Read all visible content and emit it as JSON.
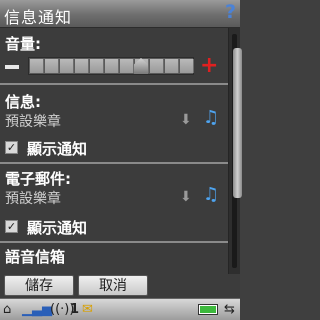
{
  "title": "信息通知",
  "help_glyph": "?",
  "volume": {
    "label": "音量:",
    "minus_glyph": "−",
    "plus_glyph": "+",
    "level": 0.7
  },
  "sections": [
    {
      "label": "信息:",
      "value": "預設樂章",
      "checkbox_label": "顯示通知",
      "checked": true
    },
    {
      "label": "電子郵件:",
      "value": "預設樂章",
      "checkbox_label": "顯示通知",
      "checked": true
    },
    {
      "label": "語音信箱"
    }
  ],
  "softkeys": {
    "left": "儲存",
    "right": "取消"
  },
  "status_icons": [
    "home-icon",
    "signal-icon",
    "vibrate-icon",
    "message-icon",
    "battery-icon",
    "connectivity-icon"
  ],
  "status_sim_number": "1",
  "colors": {
    "accent_red": "#e02020",
    "note_blue": "#4ea4f0",
    "help_blue": "#4b82d6"
  }
}
